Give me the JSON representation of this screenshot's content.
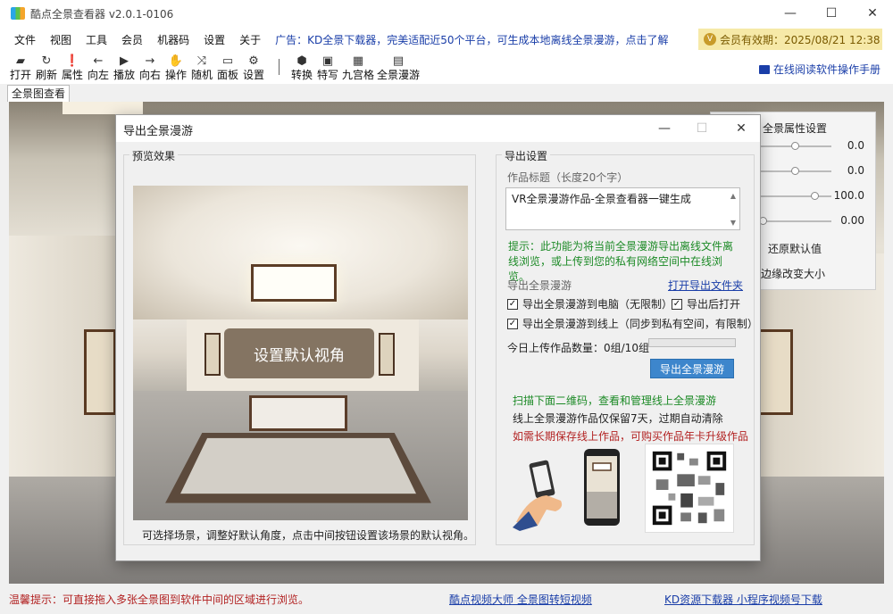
{
  "window": {
    "title": "酷点全景查看器 v2.0.1-0106",
    "minimize_glyph": "—",
    "maximize_glyph": "☐",
    "close_glyph": "✕"
  },
  "menu": {
    "items": [
      "文件",
      "视图",
      "工具",
      "会员",
      "机器码",
      "设置",
      "关于"
    ],
    "ad": "广告：KD全景下载器，完美适配近50个平台，可生成本地离线全景漫游，点击了解",
    "member": "会员有效期：2025/08/21 12:38",
    "member_icon_glyph": "V"
  },
  "toolbar": {
    "tools": [
      {
        "label": "打开",
        "icon": "folder-open-icon",
        "glyph": "▰"
      },
      {
        "label": "刷新",
        "icon": "refresh-icon",
        "glyph": "↻"
      },
      {
        "label": "属性",
        "icon": "info-icon",
        "glyph": "❗"
      },
      {
        "label": "向左",
        "icon": "arrow-left-icon",
        "glyph": "←"
      },
      {
        "label": "播放",
        "icon": "play-icon",
        "glyph": "▶"
      },
      {
        "label": "向右",
        "icon": "arrow-right-icon",
        "glyph": "→"
      },
      {
        "label": "操作",
        "icon": "hand-icon",
        "glyph": "✋"
      },
      {
        "label": "随机",
        "icon": "shuffle-icon",
        "glyph": "⤨"
      },
      {
        "label": "面板",
        "icon": "panel-icon",
        "glyph": "▭"
      },
      {
        "label": "设置",
        "icon": "gear-icon",
        "glyph": "⚙"
      }
    ],
    "tools2": [
      {
        "label": "转换",
        "icon": "cube-icon",
        "glyph": "⬢"
      },
      {
        "label": "特写",
        "icon": "image-icon",
        "glyph": "▣"
      },
      {
        "label": "九宫格",
        "icon": "grid-icon",
        "glyph": "▦"
      },
      {
        "label": "全景漫游",
        "icon": "panorama-tour-icon",
        "glyph": "▤"
      }
    ],
    "manual_link": "在线阅读软件操作手册"
  },
  "tabs": {
    "active": "全景图查看"
  },
  "property_panel": {
    "title": "全景属性设置",
    "values": [
      "0.0",
      "0.0",
      "100.0",
      "0.00"
    ],
    "reset_button": "还原默认值",
    "edge_option": "边缘改变大小"
  },
  "dialog": {
    "title": "导出全景漫游",
    "preview": {
      "group_label": "预览效果",
      "set_view_button": "设置默认视角",
      "hint": "可选择场景，调整好默认角度，点击中间按钮设置该场景的默认视角。"
    },
    "settings": {
      "group_label": "导出设置",
      "title_label": "作品标题（长度20个字）",
      "title_value": "VR全景漫游作品-全景查看器一键生成",
      "tip": "提示：此功能为将当前全景漫游导出离线文件离线浏览，或上传到您的私有网络空间中在线浏览。",
      "export_section_label": "导出全景漫游",
      "open_folder_link": "打开导出文件夹",
      "check_export_pc": {
        "label": "导出全景漫游到电脑（无限制）",
        "checked": true
      },
      "check_open_after": {
        "label": "导出后打开",
        "checked": true
      },
      "check_export_online": {
        "label": "导出全景漫游到线上（同步到私有空间，有限制）",
        "checked": true
      },
      "upload_count_label": "今日上传作品数量：0组/10组",
      "upload_progress": 0,
      "export_button": "导出全景漫游",
      "scan_hint": "扫描下面二维码，查看和管理线上全景漫游",
      "retention_note": "线上全景漫游作品仅保留7天，过期自动清除",
      "upgrade_note": "如需长期保存线上作品，可购买作品年卡升级作品"
    }
  },
  "status": {
    "tip": "温馨提示：可直接拖入多张全景图到软件中间的区域进行浏览。",
    "link1": "酷点视频大师 全景图转短视频",
    "link2": "KD资源下载器 小程序视频号下载"
  },
  "colors": {
    "accent_blue": "#3d86cc",
    "link_blue": "#1a3ea8",
    "tip_green": "#1c8a26",
    "warn_red": "#b22222",
    "member_bg": "#f6e9a8"
  }
}
